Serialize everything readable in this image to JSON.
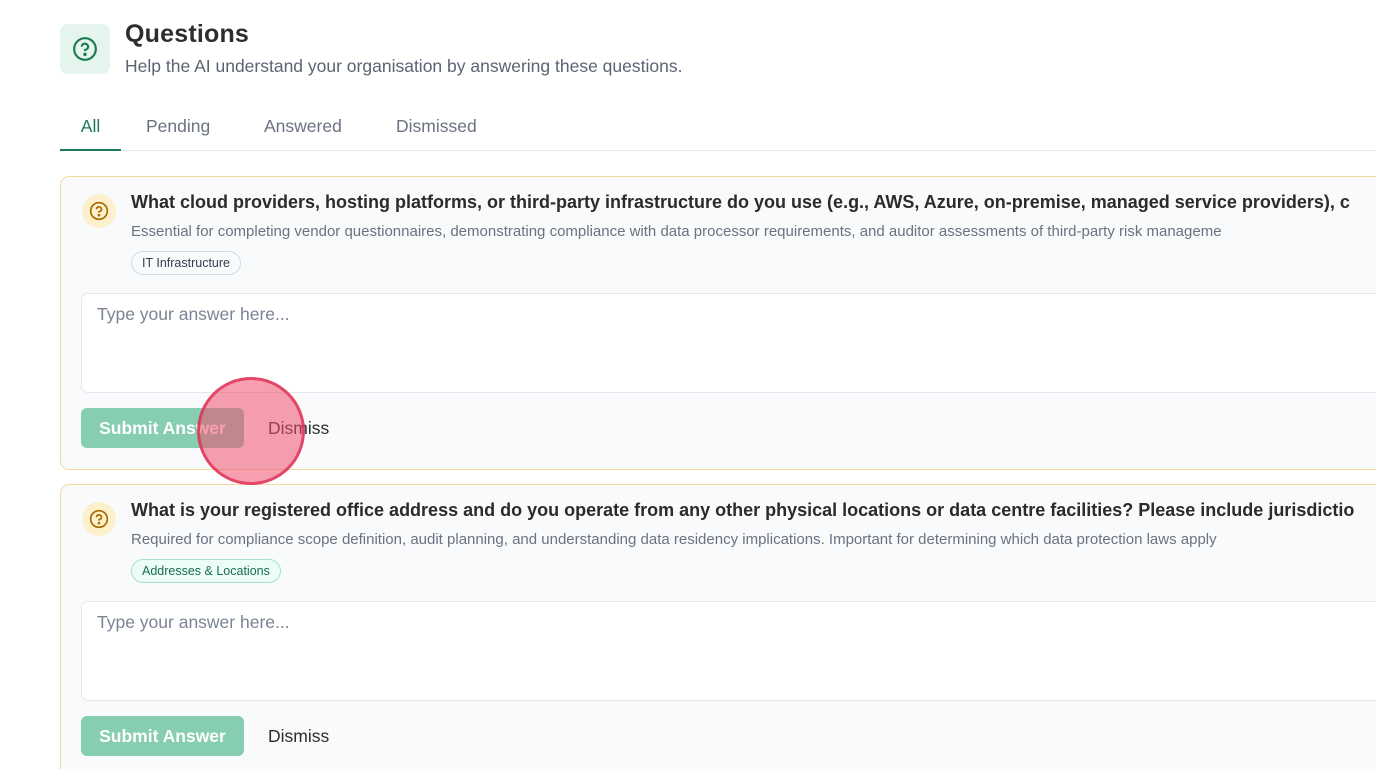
{
  "header": {
    "icon": "question-circle-icon",
    "title": "Questions",
    "subtitle": "Help the AI understand your organisation by answering these questions."
  },
  "tabs": [
    {
      "label": "All",
      "active": true
    },
    {
      "label": "Pending",
      "active": false
    },
    {
      "label": "Answered",
      "active": false
    },
    {
      "label": "Dismissed",
      "active": false
    }
  ],
  "questions": [
    {
      "icon": "question-circle-icon",
      "text": "What cloud providers, hosting platforms, or third-party infrastructure do you use (e.g., AWS, Azure, on-premise, managed service providers), c",
      "description": "Essential for completing vendor questionnaires, demonstrating compliance with data processor requirements, and auditor assessments of third-party risk manageme",
      "tag": "IT Infrastructure",
      "answer_value": "",
      "answer_placeholder": "Type your answer here...",
      "submit_label": "Submit Answer",
      "dismiss_label": "Dismiss"
    },
    {
      "icon": "question-circle-icon",
      "text": "What is your registered office address and do you operate from any other physical locations or data centre facilities? Please include jurisdictio",
      "description": "Required for compliance scope definition, audit planning, and understanding data residency implications. Important for determining which data protection laws apply",
      "tag": "Addresses & Locations",
      "answer_value": "",
      "answer_placeholder": "Type your answer here...",
      "submit_label": "Submit Answer",
      "dismiss_label": "Dismiss"
    }
  ],
  "colors": {
    "accent": "#1b7a55",
    "submit_disabled": "#86cdb2",
    "card_border": "#f5d9a3",
    "question_icon_bg": "#fdf0cc",
    "question_icon_stroke": "#a66a00",
    "click_marker": "#f0506e"
  }
}
